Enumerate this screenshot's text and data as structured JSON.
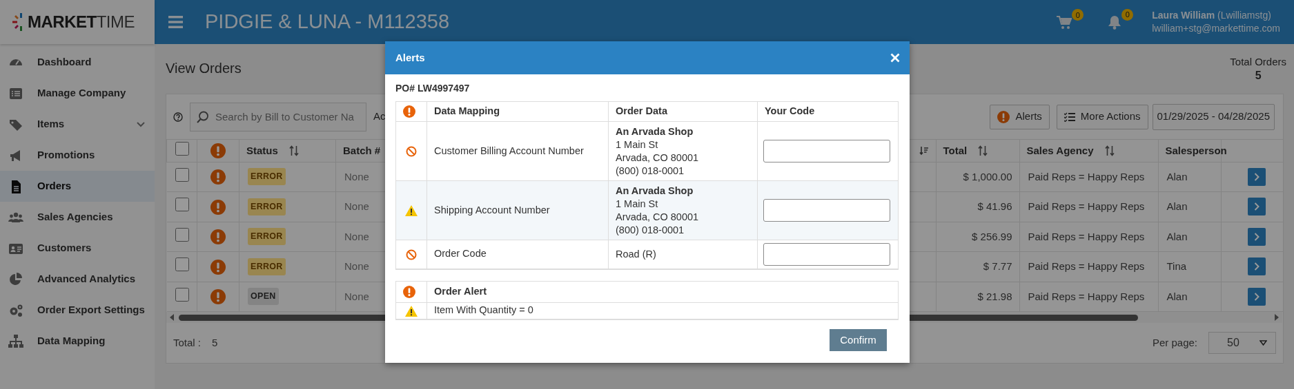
{
  "app": {
    "logo_bold": "MARKET",
    "logo_light": "TIME"
  },
  "header": {
    "title": "PIDGIE & LUNA - M112358",
    "cart_count": "0",
    "notification_count": "0",
    "user_name": "Laura William",
    "user_login": "(Lwilliamstg)",
    "user_email": "lwilliam+stg@markettime.com"
  },
  "sidebar": {
    "items": [
      {
        "label": "Dashboard",
        "selected": false,
        "has_submenu": false
      },
      {
        "label": "Manage Company",
        "selected": false,
        "has_submenu": false
      },
      {
        "label": "Items",
        "selected": false,
        "has_submenu": true
      },
      {
        "label": "Promotions",
        "selected": false,
        "has_submenu": false
      },
      {
        "label": "Orders",
        "selected": true,
        "has_submenu": false
      },
      {
        "label": "Sales Agencies",
        "selected": false,
        "has_submenu": false
      },
      {
        "label": "Customers",
        "selected": false,
        "has_submenu": false
      },
      {
        "label": "Advanced Analytics",
        "selected": false,
        "has_submenu": false
      },
      {
        "label": "Order Export Settings",
        "selected": false,
        "has_submenu": false
      },
      {
        "label": "Data Mapping",
        "selected": false,
        "has_submenu": false
      }
    ]
  },
  "page": {
    "title": "View Orders",
    "total_orders_label": "Total Orders",
    "total_orders": "5"
  },
  "toolbar": {
    "search_placeholder": "Search by Bill to Customer Na",
    "partial_button": "Ac",
    "buttons": [
      {
        "label": "Alerts",
        "kind": "alerts"
      },
      {
        "label": "More Actions",
        "kind": "actions"
      }
    ],
    "date_range": "01/29/2025 - 04/28/2025"
  },
  "table": {
    "all_selected": false,
    "columns": [
      {
        "kind": "checkbox"
      },
      {
        "kind": "alert"
      },
      {
        "kind": "text",
        "label": "Status",
        "sortable": true,
        "sorted_descending": false
      },
      {
        "kind": "text",
        "label": "Batch #",
        "sortable": false
      },
      {
        "kind": "text",
        "sortable": true,
        "sorted_descending": true
      },
      {
        "kind": "text",
        "label": "Total",
        "sortable": true,
        "sorted_descending": false
      },
      {
        "kind": "text",
        "label": "Sales Agency",
        "sortable": true,
        "sorted_descending": false
      },
      {
        "kind": "text",
        "label": "Salesperson",
        "sortable": false
      },
      {
        "kind": "action"
      }
    ],
    "rows": [
      {
        "checked": false,
        "status": "ERROR",
        "kind": "error",
        "batch": "None",
        "total": "$ 1,000.00",
        "sales_agency": "Paid Reps = Happy Reps",
        "salesperson": "Alan"
      },
      {
        "checked": false,
        "status": "ERROR",
        "kind": "error",
        "batch": "None",
        "total": "$ 41.96",
        "sales_agency": "Paid Reps = Happy Reps",
        "salesperson": "Alan"
      },
      {
        "checked": false,
        "status": "ERROR",
        "kind": "error",
        "batch": "None",
        "total": "$ 256.99",
        "sales_agency": "Paid Reps = Happy Reps",
        "salesperson": "Alan"
      },
      {
        "checked": false,
        "status": "ERROR",
        "kind": "error",
        "batch": "None",
        "total": "$ 7.77",
        "sales_agency": "Paid Reps = Happy Reps",
        "salesperson": "Tina"
      },
      {
        "checked": false,
        "status": "OPEN",
        "kind": "open",
        "batch": "None",
        "total": "$ 21.98",
        "sales_agency": "Paid Reps = Happy Reps",
        "salesperson": "Alan"
      }
    ]
  },
  "footer": {
    "total_label": "Total :",
    "total": "5",
    "per_page_label": "Per page:",
    "per_page": "50"
  },
  "modal": {
    "title": "Alerts",
    "po": "PO# LW4997497",
    "mapping_columns": [
      "Data Mapping",
      "Order Data",
      "Your Code"
    ],
    "mappings": [
      {
        "kind": "error",
        "label": "Customer Billing Account Number",
        "order_data": {
          "name": "An Arvada Shop",
          "lines": [
            "1 Main St",
            "Arvada, CO 80001",
            "(800) 018-0001"
          ]
        },
        "highlighted": false
      },
      {
        "kind": "warning",
        "label": "Shipping Account Number",
        "order_data": {
          "name": "An Arvada Shop",
          "lines": [
            "1 Main St",
            "Arvada, CO 80001",
            "(800) 018-0001"
          ]
        },
        "highlighted": true
      },
      {
        "kind": "error",
        "label": "Order Code",
        "order_data": {
          "lines": [
            "Road (R)"
          ]
        },
        "highlighted": false
      }
    ],
    "alerts_heading": "Order Alert",
    "alerts": [
      {
        "kind": "warning",
        "text": "Item With Quantity = 0"
      }
    ],
    "confirm": "Confirm"
  }
}
